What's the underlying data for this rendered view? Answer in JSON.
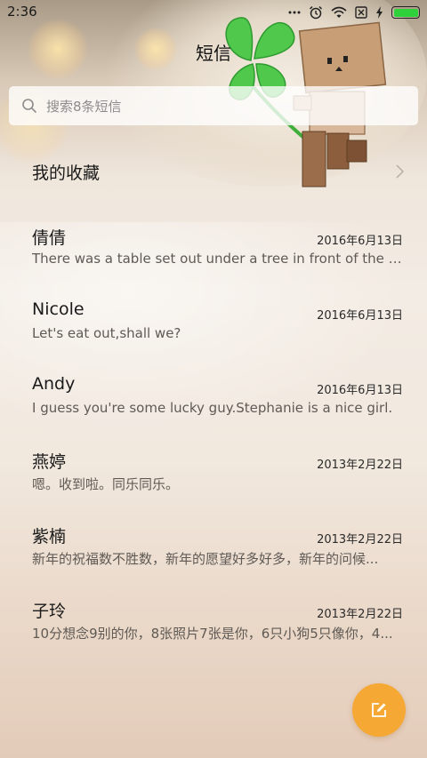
{
  "status_bar": {
    "time": "2:36",
    "icons": [
      "signal-dots-icon",
      "alarm-icon",
      "wifi-icon",
      "sim-off-icon",
      "charging-bolt-icon",
      "battery-icon"
    ],
    "battery_level": 1.0,
    "battery_color": "#2fd13a"
  },
  "header": {
    "title": "短信"
  },
  "search": {
    "placeholder": "搜索8条短信"
  },
  "favorites": {
    "label": "我的收藏"
  },
  "conversations": [
    {
      "name": "倩倩",
      "date": "2016年6月13日",
      "preview": "There was a table set out under a tree in front of the ho..."
    },
    {
      "name": "Nicole",
      "date": "2016年6月13日",
      "preview": "Let's eat out,shall we?"
    },
    {
      "name": "Andy",
      "date": "2016年6月13日",
      "preview": "I guess you're some lucky guy.Stephanie is a nice girl."
    },
    {
      "name": "燕婷",
      "date": "2013年2月22日",
      "preview": "嗯。收到啦。同乐同乐。"
    },
    {
      "name": "紫楠",
      "date": "2013年2月22日",
      "preview": "新年的祝福数不胜数，新年的愿望好多好多，新年的问候..."
    },
    {
      "name": "子玲",
      "date": "2013年2月22日",
      "preview": "10分想念9别的你，8张照片7张是你，6只小狗5只像你，4..."
    }
  ],
  "compose": {
    "icon": "compose-icon",
    "color": "#f5a833"
  }
}
